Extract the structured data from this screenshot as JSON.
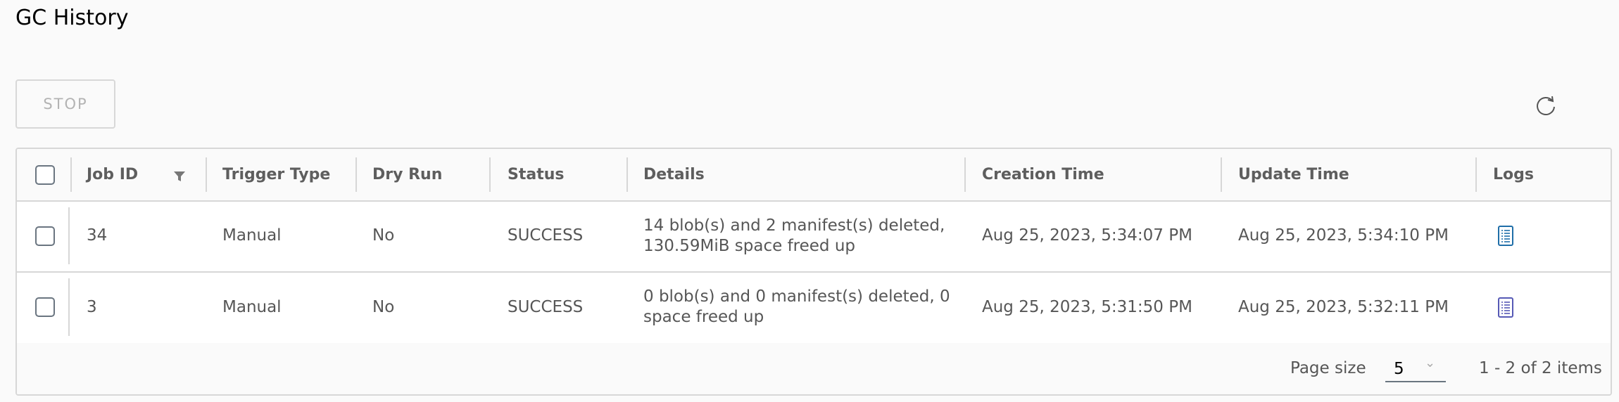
{
  "page": {
    "title": "GC History"
  },
  "toolbar": {
    "stop_label": "STOP",
    "refresh_icon": "refresh-icon"
  },
  "table": {
    "columns": [
      "Job ID",
      "Trigger Type",
      "Dry Run",
      "Status",
      "Details",
      "Creation Time",
      "Update Time",
      "Logs"
    ],
    "rows": [
      {
        "job_id": "34",
        "trigger_type": "Manual",
        "dry_run": "No",
        "status": "SUCCESS",
        "details": "14 blob(s) and 2 manifest(s) deleted, 130.59MiB space freed up",
        "creation_time": "Aug 25, 2023, 5:34:07 PM",
        "update_time": "Aug 25, 2023, 5:34:10 PM",
        "log_icon": "log-document-icon",
        "log_color": "#1f6ea8"
      },
      {
        "job_id": "3",
        "trigger_type": "Manual",
        "dry_run": "No",
        "status": "SUCCESS",
        "details": "0 blob(s) and 0 manifest(s) deleted, 0 space freed up",
        "creation_time": "Aug 25, 2023, 5:31:50 PM",
        "update_time": "Aug 25, 2023, 5:32:11 PM",
        "log_icon": "log-document-icon",
        "log_color": "#5659b5"
      }
    ]
  },
  "footer": {
    "page_size_label": "Page size",
    "page_size_value": "5",
    "items_summary": "1 - 2 of 2 items"
  }
}
